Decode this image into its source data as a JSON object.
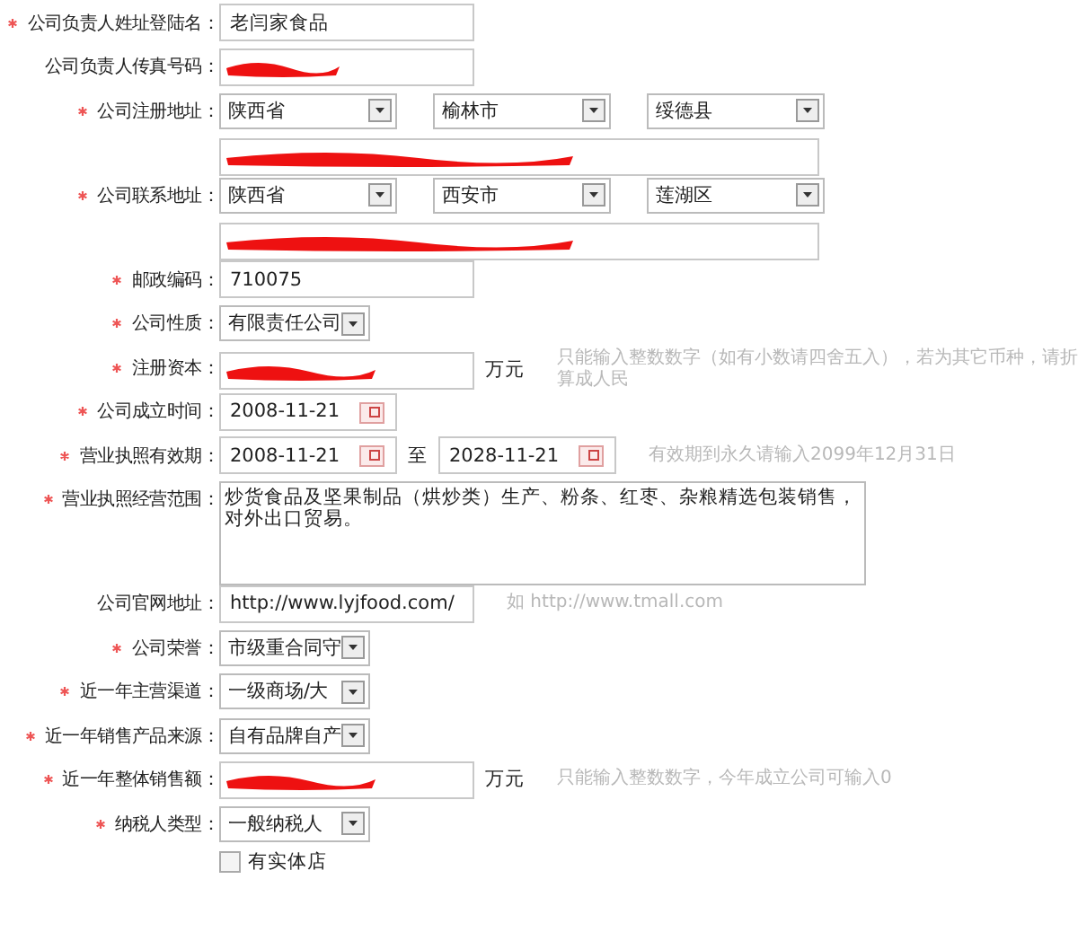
{
  "fields": [
    {
      "kind": "text",
      "label": "公司负责人姓址登陆名：",
      "required": true,
      "value": "老闫家食品"
    },
    {
      "kind": "text",
      "label": "公司负责人传真号码：",
      "required": false,
      "redacted": true
    },
    {
      "kind": "address",
      "label": "公司注册地址：",
      "required": true,
      "selects": [
        "陕西省",
        "榆林市",
        "绥德县"
      ],
      "line_redacted": true
    },
    {
      "kind": "address",
      "label": "公司联系地址：",
      "required": true,
      "selects": [
        "陕西省",
        "西安市",
        "莲湖区"
      ],
      "line_redacted": true
    },
    {
      "kind": "text",
      "label": "邮政编码：",
      "required": true,
      "value": "710075"
    },
    {
      "kind": "select",
      "label": "公司性质：",
      "required": true,
      "value": "有限责任公司"
    },
    {
      "kind": "text",
      "label": "注册资本：",
      "required": true,
      "redacted": true,
      "unit": "万元",
      "hint": "只能输入整数数字（如有小数请四舍五入），若为其它币种，请折算成人民"
    },
    {
      "kind": "date",
      "label": "公司成立时间：",
      "required": true,
      "value": "2008-11-21"
    },
    {
      "kind": "date_range",
      "label": "营业执照有效期：",
      "required": true,
      "from": "2008-11-21",
      "separator": "至",
      "to": "2028-11-21",
      "hint": "有效期到永久请输入2099年12月31日"
    },
    {
      "kind": "textarea",
      "label": "营业执照经营范围：",
      "required": true,
      "lines": [
        "炒货食品及坚果制品（烘炒类）生产、粉条、红枣、杂粮精选包装销售，",
        "对外出口贸易。"
      ]
    },
    {
      "kind": "text",
      "label": "公司官网地址：",
      "required": false,
      "value": "http://www.lyjfood.com/",
      "hint": "如 http://www.tmall.com"
    },
    {
      "kind": "select",
      "label": "公司荣誉：",
      "required": true,
      "value": "市级重合同守"
    },
    {
      "kind": "select",
      "label": "近一年主营渠道：",
      "required": true,
      "value": "一级商场/大"
    },
    {
      "kind": "select",
      "label": "近一年销售产品来源：",
      "required": true,
      "value": "自有品牌自产"
    },
    {
      "kind": "text",
      "label": "近一年整体销售额：",
      "required": true,
      "redacted": true,
      "unit": "万元",
      "hint": "只能输入整数数字，今年成立公司可输入0"
    },
    {
      "kind": "select",
      "label": "纳税人类型：",
      "required": true,
      "value": "一般纳税人"
    },
    {
      "kind": "checkbox",
      "label": "有实体店",
      "checked": false
    }
  ]
}
